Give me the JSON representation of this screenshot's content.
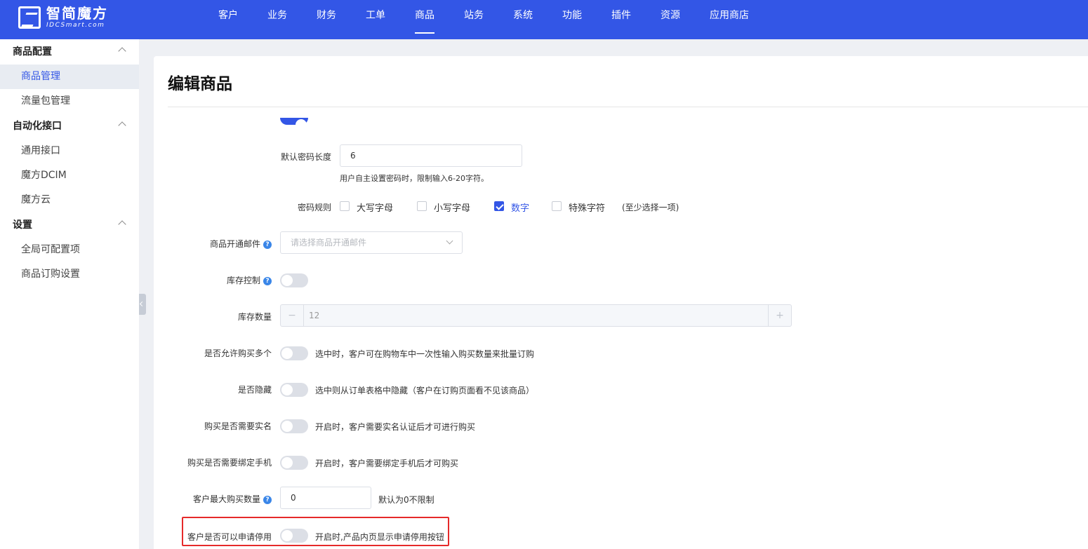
{
  "brand": {
    "name_cn": "智简魔方",
    "name_en": "IDCSmart.com"
  },
  "nav": [
    "客户",
    "业务",
    "财务",
    "工单",
    "商品",
    "站务",
    "系统",
    "功能",
    "插件",
    "资源",
    "应用商店"
  ],
  "nav_active": "商品",
  "sidebar": {
    "groups": [
      {
        "title": "商品配置",
        "items": [
          "商品管理",
          "流量包管理"
        ]
      },
      {
        "title": "自动化接口",
        "items": [
          "通用接口",
          "魔方DCIM",
          "魔方云"
        ]
      },
      {
        "title": "设置",
        "items": [
          "全局可配置项",
          "商品订购设置"
        ]
      }
    ],
    "active": "商品管理"
  },
  "page": {
    "title": "编辑商品"
  },
  "form": {
    "pwd_length": {
      "label": "默认密码长度",
      "value": "6",
      "hint": "用户自主设置密码时，限制输入6-20字符。"
    },
    "pwd_rule": {
      "label": "密码规则",
      "options": [
        {
          "label": "大写字母",
          "checked": false
        },
        {
          "label": "小写字母",
          "checked": false
        },
        {
          "label": "数字",
          "checked": true
        },
        {
          "label": "特殊字符",
          "checked": false
        }
      ],
      "note": "(至少选择一项)"
    },
    "open_mail": {
      "label": "商品开通邮件",
      "placeholder": "请选择商品开通邮件"
    },
    "stock_control": {
      "label": "库存控制",
      "on": false
    },
    "stock_qty": {
      "label": "库存数量",
      "value": "12",
      "minus": "−",
      "plus": "+"
    },
    "multi_buy": {
      "label": "是否允许购买多个",
      "hint": "选中时，客户可在购物车中一次性输入购买数量来批量订购"
    },
    "hidden": {
      "label": "是否隐藏",
      "hint": "选中则从订单表格中隐藏（客户在订购页面看不见该商品）"
    },
    "realname": {
      "label": "购买是否需要实名",
      "hint": "开启时，客户需要实名认证后才可进行购买"
    },
    "bind_phone": {
      "label": "购买是否需要绑定手机",
      "hint": "开启时，客户需要绑定手机后才可购买"
    },
    "max_buy": {
      "label": "客户最大购买数量",
      "value": "0",
      "hint": "默认为0不限制"
    },
    "can_suspend": {
      "label": "客户是否可以申请停用",
      "hint": "开启时,产品内页显示申请停用按钮"
    }
  },
  "colors": {
    "primary": "#3356e6",
    "highlight_border": "#e62a2a"
  }
}
